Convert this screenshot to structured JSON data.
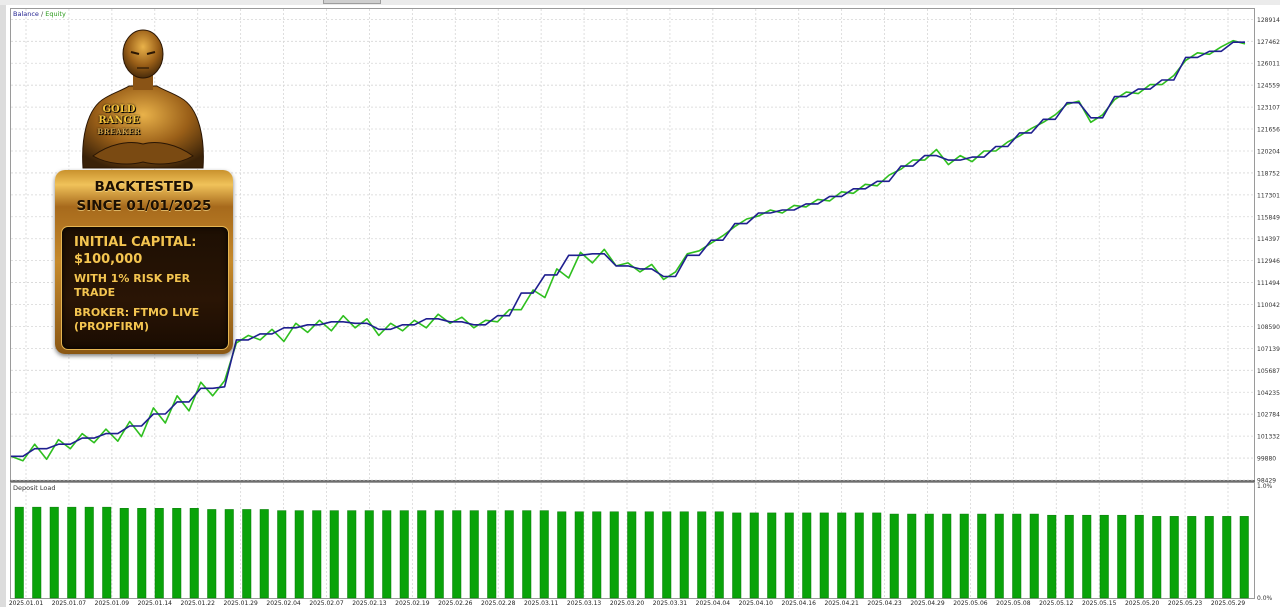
{
  "badge": {
    "logo_line1": "GOLD",
    "logo_line2": "RANGE",
    "logo_line3": "BREAKER",
    "header_line1": "BACKTESTED",
    "header_line2": "SINCE 01/01/2025",
    "capital_line1": "INITIAL CAPITAL:",
    "capital_line2": "$100,000",
    "risk_line1": "WITH 1% RISK PER",
    "risk_line2": "TRADE",
    "broker_line1": "BROKER: FTMO LIVE",
    "broker_line2": "(PROPFIRM)"
  },
  "colors": {
    "balance": "#1f1f8f",
    "equity": "#2fbf1f",
    "bars": "#0aa30a",
    "grid": "#d6d6d6"
  },
  "chart_data": [
    {
      "type": "line",
      "title_part1": "Balance",
      "title_sep": " / ",
      "title_part2": "Equity",
      "y_ticks": [
        "128914",
        "127462",
        "126011",
        "124559",
        "123107",
        "121656",
        "120204",
        "118752",
        "117301",
        "115849",
        "114397",
        "112946",
        "111494",
        "110042",
        "108590",
        "107139",
        "105687",
        "104235",
        "102784",
        "101332",
        "99880",
        "98429"
      ],
      "ylim": [
        98429,
        129600
      ],
      "x_ticks": [
        "2025.01.01",
        "2025.01.07",
        "2025.01.09",
        "2025.01.14",
        "2025.01.22",
        "2025.01.29",
        "2025.02.04",
        "2025.02.07",
        "2025.02.13",
        "2025.02.19",
        "2025.02.26",
        "2025.02.28",
        "2025.03.11",
        "2025.03.13",
        "2025.03.20",
        "2025.03.31",
        "2025.04.04",
        "2025.04.10",
        "2025.04.16",
        "2025.04.21",
        "2025.04.23",
        "2025.04.29",
        "2025.05.06",
        "2025.05.08",
        "2025.05.12",
        "2025.05.15",
        "2025.05.20",
        "2025.05.23",
        "2025.05.29"
      ],
      "grid": true,
      "series": [
        {
          "name": "Balance",
          "values": [
            100000,
            100000,
            100500,
            100500,
            100800,
            100800,
            101200,
            101200,
            101500,
            101500,
            102000,
            102000,
            102800,
            102800,
            103600,
            103600,
            104500,
            104500,
            104600,
            107700,
            107700,
            108100,
            108100,
            108500,
            108500,
            108700,
            108700,
            108900,
            108900,
            108800,
            108800,
            108400,
            108400,
            108700,
            108700,
            109100,
            109100,
            108900,
            108900,
            108700,
            108700,
            109300,
            109300,
            110800,
            110800,
            112000,
            112000,
            113300,
            113300,
            113400,
            113400,
            112600,
            112600,
            112400,
            112400,
            111900,
            111900,
            113300,
            113300,
            114300,
            114300,
            115400,
            115400,
            116100,
            116100,
            116300,
            116300,
            116700,
            116700,
            117200,
            117200,
            117700,
            117700,
            118200,
            118200,
            119200,
            119200,
            119900,
            119900,
            119600,
            119600,
            119800,
            119800,
            120500,
            120500,
            121400,
            121400,
            122300,
            122300,
            123400,
            123400,
            122400,
            122400,
            123800,
            123800,
            124300,
            124300,
            124900,
            124900,
            126400,
            126400,
            126800,
            126800,
            127400,
            127400
          ]
        },
        {
          "name": "Equity",
          "values": [
            100000,
            99700,
            100800,
            99800,
            101100,
            100500,
            101500,
            100900,
            101800,
            101000,
            102300,
            101300,
            103200,
            102200,
            104000,
            103000,
            104900,
            104000,
            105000,
            107500,
            108000,
            107700,
            108400,
            107600,
            108800,
            108200,
            109000,
            108300,
            109300,
            108500,
            109100,
            108000,
            108800,
            108300,
            109000,
            108500,
            109400,
            108800,
            109200,
            108500,
            109000,
            108900,
            109700,
            109700,
            111000,
            110500,
            112400,
            111800,
            113500,
            112800,
            113700,
            112600,
            112800,
            112200,
            112700,
            111700,
            112200,
            113400,
            113600,
            114100,
            114600,
            115200,
            115700,
            115900,
            116300,
            116100,
            116600,
            116500,
            117000,
            116900,
            117500,
            117400,
            118000,
            117900,
            118600,
            119000,
            119600,
            119600,
            120300,
            119300,
            119900,
            119500,
            120200,
            120200,
            120800,
            121200,
            121700,
            122100,
            122600,
            123300,
            123500,
            122100,
            122600,
            123600,
            124100,
            124000,
            124600,
            124600,
            125200,
            126200,
            126700,
            126600,
            127100,
            127500,
            127300
          ]
        }
      ]
    },
    {
      "type": "bar",
      "title": "Deposit Load",
      "y_ticks": [
        "1.0%",
        "0.0%"
      ],
      "ylim": [
        0,
        1.0
      ],
      "values": [
        0.79,
        0.79,
        0.79,
        0.79,
        0.79,
        0.79,
        0.78,
        0.78,
        0.78,
        0.78,
        0.78,
        0.77,
        0.77,
        0.77,
        0.77,
        0.76,
        0.76,
        0.76,
        0.76,
        0.76,
        0.76,
        0.76,
        0.76,
        0.76,
        0.76,
        0.76,
        0.76,
        0.76,
        0.76,
        0.76,
        0.76,
        0.75,
        0.75,
        0.75,
        0.75,
        0.75,
        0.75,
        0.75,
        0.75,
        0.75,
        0.75,
        0.74,
        0.74,
        0.74,
        0.74,
        0.74,
        0.74,
        0.74,
        0.74,
        0.74,
        0.73,
        0.73,
        0.73,
        0.73,
        0.73,
        0.73,
        0.73,
        0.73,
        0.73,
        0.72,
        0.72,
        0.72,
        0.72,
        0.72,
        0.72,
        0.71,
        0.71,
        0.71,
        0.71,
        0.71,
        0.71
      ]
    }
  ]
}
